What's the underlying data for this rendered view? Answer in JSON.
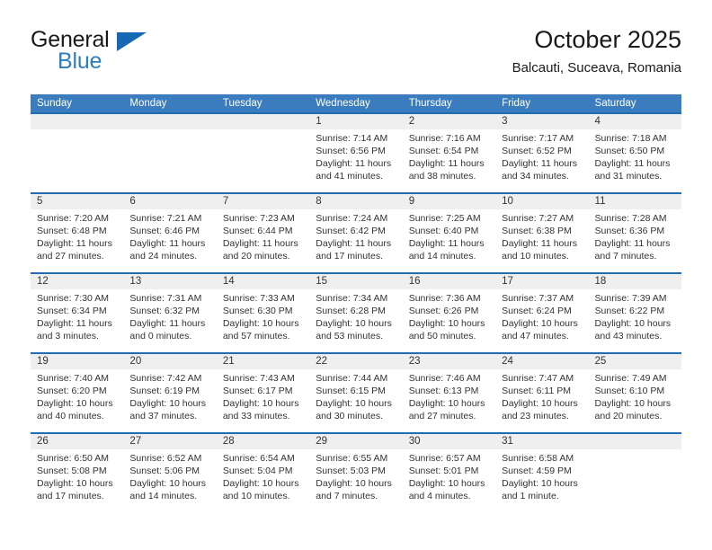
{
  "brand": {
    "name_part1": "General",
    "name_part2": "Blue",
    "logo_icon": "triangle-flag-icon",
    "accent_color": "#1668b3"
  },
  "header": {
    "month_title": "October 2025",
    "location": "Balcauti, Suceava, Romania"
  },
  "theme": {
    "header_blue": "#3a7cbe",
    "separator_blue": "#1f6cb0",
    "daynum_band": "#efefef",
    "text": "#333333"
  },
  "weekday_headers": [
    "Sunday",
    "Monday",
    "Tuesday",
    "Wednesday",
    "Thursday",
    "Friday",
    "Saturday"
  ],
  "weeks": [
    [
      {
        "day": "",
        "sunrise": "",
        "sunset": "",
        "daylight_line1": "",
        "daylight_line2": ""
      },
      {
        "day": "",
        "sunrise": "",
        "sunset": "",
        "daylight_line1": "",
        "daylight_line2": ""
      },
      {
        "day": "",
        "sunrise": "",
        "sunset": "",
        "daylight_line1": "",
        "daylight_line2": ""
      },
      {
        "day": "1",
        "sunrise": "Sunrise: 7:14 AM",
        "sunset": "Sunset: 6:56 PM",
        "daylight_line1": "Daylight: 11 hours",
        "daylight_line2": "and 41 minutes."
      },
      {
        "day": "2",
        "sunrise": "Sunrise: 7:16 AM",
        "sunset": "Sunset: 6:54 PM",
        "daylight_line1": "Daylight: 11 hours",
        "daylight_line2": "and 38 minutes."
      },
      {
        "day": "3",
        "sunrise": "Sunrise: 7:17 AM",
        "sunset": "Sunset: 6:52 PM",
        "daylight_line1": "Daylight: 11 hours",
        "daylight_line2": "and 34 minutes."
      },
      {
        "day": "4",
        "sunrise": "Sunrise: 7:18 AM",
        "sunset": "Sunset: 6:50 PM",
        "daylight_line1": "Daylight: 11 hours",
        "daylight_line2": "and 31 minutes."
      }
    ],
    [
      {
        "day": "5",
        "sunrise": "Sunrise: 7:20 AM",
        "sunset": "Sunset: 6:48 PM",
        "daylight_line1": "Daylight: 11 hours",
        "daylight_line2": "and 27 minutes."
      },
      {
        "day": "6",
        "sunrise": "Sunrise: 7:21 AM",
        "sunset": "Sunset: 6:46 PM",
        "daylight_line1": "Daylight: 11 hours",
        "daylight_line2": "and 24 minutes."
      },
      {
        "day": "7",
        "sunrise": "Sunrise: 7:23 AM",
        "sunset": "Sunset: 6:44 PM",
        "daylight_line1": "Daylight: 11 hours",
        "daylight_line2": "and 20 minutes."
      },
      {
        "day": "8",
        "sunrise": "Sunrise: 7:24 AM",
        "sunset": "Sunset: 6:42 PM",
        "daylight_line1": "Daylight: 11 hours",
        "daylight_line2": "and 17 minutes."
      },
      {
        "day": "9",
        "sunrise": "Sunrise: 7:25 AM",
        "sunset": "Sunset: 6:40 PM",
        "daylight_line1": "Daylight: 11 hours",
        "daylight_line2": "and 14 minutes."
      },
      {
        "day": "10",
        "sunrise": "Sunrise: 7:27 AM",
        "sunset": "Sunset: 6:38 PM",
        "daylight_line1": "Daylight: 11 hours",
        "daylight_line2": "and 10 minutes."
      },
      {
        "day": "11",
        "sunrise": "Sunrise: 7:28 AM",
        "sunset": "Sunset: 6:36 PM",
        "daylight_line1": "Daylight: 11 hours",
        "daylight_line2": "and 7 minutes."
      }
    ],
    [
      {
        "day": "12",
        "sunrise": "Sunrise: 7:30 AM",
        "sunset": "Sunset: 6:34 PM",
        "daylight_line1": "Daylight: 11 hours",
        "daylight_line2": "and 3 minutes."
      },
      {
        "day": "13",
        "sunrise": "Sunrise: 7:31 AM",
        "sunset": "Sunset: 6:32 PM",
        "daylight_line1": "Daylight: 11 hours",
        "daylight_line2": "and 0 minutes."
      },
      {
        "day": "14",
        "sunrise": "Sunrise: 7:33 AM",
        "sunset": "Sunset: 6:30 PM",
        "daylight_line1": "Daylight: 10 hours",
        "daylight_line2": "and 57 minutes."
      },
      {
        "day": "15",
        "sunrise": "Sunrise: 7:34 AM",
        "sunset": "Sunset: 6:28 PM",
        "daylight_line1": "Daylight: 10 hours",
        "daylight_line2": "and 53 minutes."
      },
      {
        "day": "16",
        "sunrise": "Sunrise: 7:36 AM",
        "sunset": "Sunset: 6:26 PM",
        "daylight_line1": "Daylight: 10 hours",
        "daylight_line2": "and 50 minutes."
      },
      {
        "day": "17",
        "sunrise": "Sunrise: 7:37 AM",
        "sunset": "Sunset: 6:24 PM",
        "daylight_line1": "Daylight: 10 hours",
        "daylight_line2": "and 47 minutes."
      },
      {
        "day": "18",
        "sunrise": "Sunrise: 7:39 AM",
        "sunset": "Sunset: 6:22 PM",
        "daylight_line1": "Daylight: 10 hours",
        "daylight_line2": "and 43 minutes."
      }
    ],
    [
      {
        "day": "19",
        "sunrise": "Sunrise: 7:40 AM",
        "sunset": "Sunset: 6:20 PM",
        "daylight_line1": "Daylight: 10 hours",
        "daylight_line2": "and 40 minutes."
      },
      {
        "day": "20",
        "sunrise": "Sunrise: 7:42 AM",
        "sunset": "Sunset: 6:19 PM",
        "daylight_line1": "Daylight: 10 hours",
        "daylight_line2": "and 37 minutes."
      },
      {
        "day": "21",
        "sunrise": "Sunrise: 7:43 AM",
        "sunset": "Sunset: 6:17 PM",
        "daylight_line1": "Daylight: 10 hours",
        "daylight_line2": "and 33 minutes."
      },
      {
        "day": "22",
        "sunrise": "Sunrise: 7:44 AM",
        "sunset": "Sunset: 6:15 PM",
        "daylight_line1": "Daylight: 10 hours",
        "daylight_line2": "and 30 minutes."
      },
      {
        "day": "23",
        "sunrise": "Sunrise: 7:46 AM",
        "sunset": "Sunset: 6:13 PM",
        "daylight_line1": "Daylight: 10 hours",
        "daylight_line2": "and 27 minutes."
      },
      {
        "day": "24",
        "sunrise": "Sunrise: 7:47 AM",
        "sunset": "Sunset: 6:11 PM",
        "daylight_line1": "Daylight: 10 hours",
        "daylight_line2": "and 23 minutes."
      },
      {
        "day": "25",
        "sunrise": "Sunrise: 7:49 AM",
        "sunset": "Sunset: 6:10 PM",
        "daylight_line1": "Daylight: 10 hours",
        "daylight_line2": "and 20 minutes."
      }
    ],
    [
      {
        "day": "26",
        "sunrise": "Sunrise: 6:50 AM",
        "sunset": "Sunset: 5:08 PM",
        "daylight_line1": "Daylight: 10 hours",
        "daylight_line2": "and 17 minutes."
      },
      {
        "day": "27",
        "sunrise": "Sunrise: 6:52 AM",
        "sunset": "Sunset: 5:06 PM",
        "daylight_line1": "Daylight: 10 hours",
        "daylight_line2": "and 14 minutes."
      },
      {
        "day": "28",
        "sunrise": "Sunrise: 6:54 AM",
        "sunset": "Sunset: 5:04 PM",
        "daylight_line1": "Daylight: 10 hours",
        "daylight_line2": "and 10 minutes."
      },
      {
        "day": "29",
        "sunrise": "Sunrise: 6:55 AM",
        "sunset": "Sunset: 5:03 PM",
        "daylight_line1": "Daylight: 10 hours",
        "daylight_line2": "and 7 minutes."
      },
      {
        "day": "30",
        "sunrise": "Sunrise: 6:57 AM",
        "sunset": "Sunset: 5:01 PM",
        "daylight_line1": "Daylight: 10 hours",
        "daylight_line2": "and 4 minutes."
      },
      {
        "day": "31",
        "sunrise": "Sunrise: 6:58 AM",
        "sunset": "Sunset: 4:59 PM",
        "daylight_line1": "Daylight: 10 hours",
        "daylight_line2": "and 1 minute."
      },
      {
        "day": "",
        "sunrise": "",
        "sunset": "",
        "daylight_line1": "",
        "daylight_line2": ""
      }
    ]
  ]
}
